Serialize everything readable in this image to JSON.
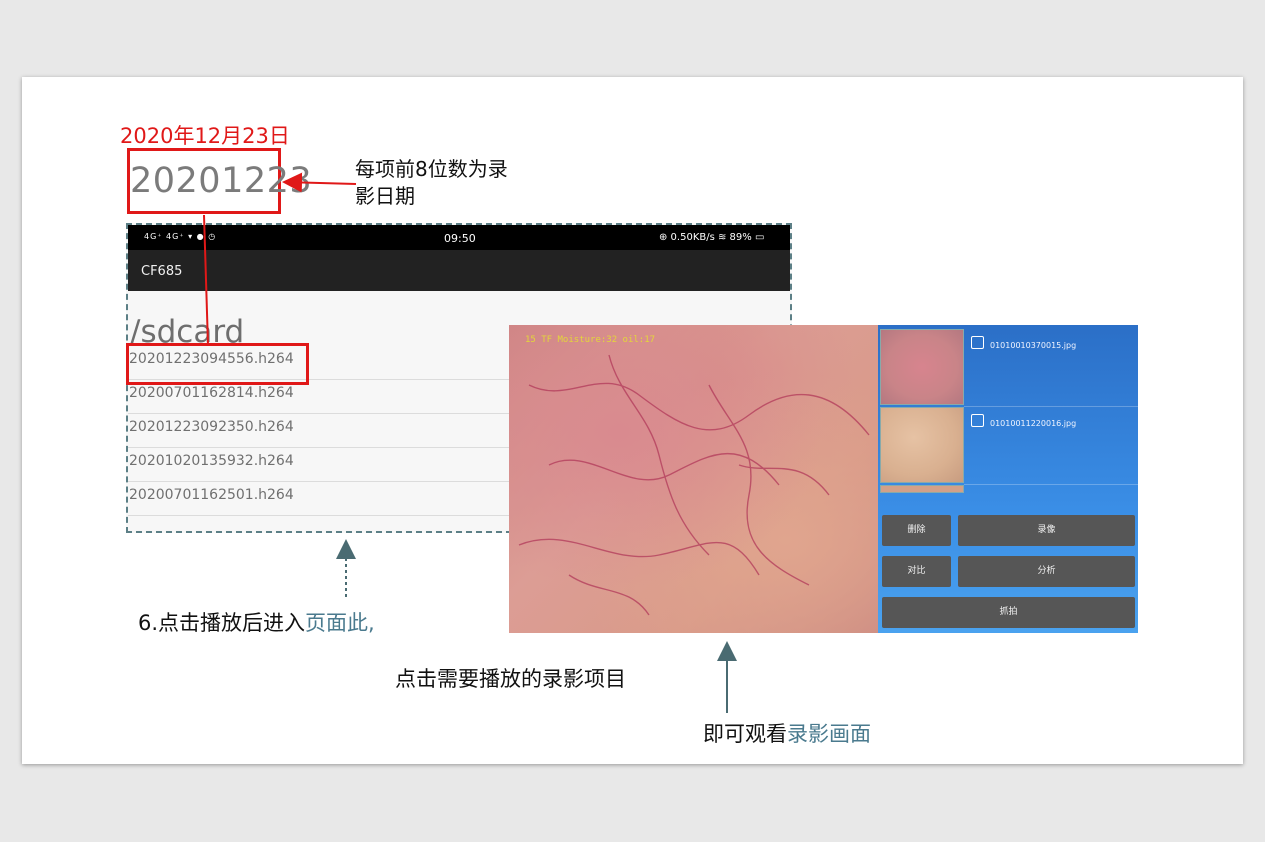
{
  "annotation": {
    "date_cn": "2020年12月23日",
    "big_date": "20201223",
    "callout_line1": "每项前8位数为录",
    "callout_line2": "影日期",
    "step_prefix": "6.点击播放后进入",
    "step_highlight": "页面此,",
    "hint_select": "点击需要播放的录影项目",
    "hint_view_prefix": "即可观看",
    "hint_view_highlight": "录影画面"
  },
  "phone": {
    "status_left": "4G⁺ 4G⁺ ▾ ● ◷",
    "time": "09:50",
    "status_right": "⊕ 0.50KB/s ≋ 89% ▭",
    "app_title": "CF685",
    "path": "/sdcard",
    "files": [
      "20201223094556.h264",
      "20200701162814.h264",
      "20201223092350.h264",
      "20201020135932.h264",
      "20200701162501.h264"
    ]
  },
  "player": {
    "overlay": "15 TF  Moisture:32 oil:17",
    "files": [
      "01010010370015.jpg",
      "01010011220016.jpg"
    ],
    "buttons": {
      "delete": "删除",
      "record": "录像",
      "compare": "对比",
      "analyze": "分析",
      "capture": "抓拍"
    }
  },
  "colors": {
    "highlight_red": "#e01818",
    "accent_teal": "#4a7a8e",
    "panel_blue": "#2b6fc7"
  }
}
